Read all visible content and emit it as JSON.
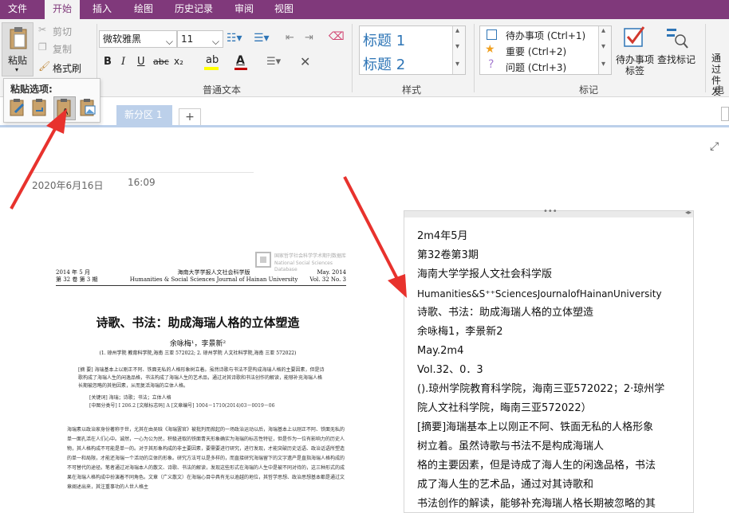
{
  "menu": {
    "tabs": [
      "文件",
      "开始",
      "插入",
      "绘图",
      "历史记录",
      "审阅",
      "视图"
    ],
    "active": "开始"
  },
  "ribbon": {
    "clipboard": {
      "paste": "粘贴",
      "cut": "剪切",
      "copy": "复制",
      "format_painter": "格式刷"
    },
    "font": {
      "name": "微软雅黑",
      "size": "11",
      "group_label": "普通文本",
      "bold": "B",
      "italic": "I",
      "underline": "U",
      "strike": "abc",
      "subscript": "x₂",
      "font_color_letter": "A"
    },
    "styles": {
      "items": [
        "标题 1",
        "标题 2"
      ],
      "group_label": "样式"
    },
    "tags": {
      "items": [
        "待办事项 (Ctrl+1)",
        "重要 (Ctrl+2)",
        "问题 (Ctrl+3)"
      ],
      "todo_tag": "待办事项\n标签",
      "todo_line1": "待办事项",
      "todo_line2": "标签",
      "find_tags": "查找标记",
      "group_label": "标记"
    },
    "partial": {
      "line1": "通过",
      "line2": "件发",
      "line3": "电子"
    }
  },
  "paste_options": {
    "title": "粘贴选项:"
  },
  "sections": {
    "active": "新分区 1",
    "add": "+"
  },
  "page": {
    "date": "2020年6月16日",
    "time": "16:09"
  },
  "document": {
    "header_left_1": "2014 年 5 月",
    "header_left_2": "第 32 卷 第 3 期",
    "header_center_1": "海南大学学报人文社会科学版",
    "header_center_2": "Humanities & Social Sciences Journal of Hainan University",
    "header_right_1": "May. 2014",
    "header_right_2": "Vol. 32  No. 3",
    "watermark_1": "国家哲学社会科学学术期刊数据库",
    "watermark_2": "National Social Sciences Database",
    "title": "诗歌、书法：助成海瑞人格的立体塑造",
    "authors": "余咏梅¹，李景新²",
    "affiliation": "(1. 琼州学院 教育科学院,海南 三亚 572022; 2. 琼州学院 人文社科学院,海南 三亚 572022)",
    "abstract": "[摘  要] 海瑞基本上以刚正不阿、铁面无私的人格形象树立着。虽然诗歌与书法不是构成海瑞人格的主要因素，但是诗歌构成了海瑞人生的闲逸品格，书法构成了海瑞人生的艺术品，通过对其诗歌和书法创作的解读，能够补充海瑞人格长期被忽略的其他因素，从而复活海瑞的立体人格。",
    "keywords": "[关键词] 海瑞；诗歌；书法；立体人格",
    "classification": "[中图分类号] I 206.2     [文献标志码] A     [文章编号] 1004－1710(2014)03－0019－06",
    "body": "海瑞素以政治家身份著称于世，尤其在由吴晗《海瑞罢官》被批判而掀起的一场政治运动以后，海瑞基本上以刚正不阿、铁面无私的单一面孔活在人们心中。诚然，一心为公为民，积极进取的铁面青天形象确实为海瑞的标志性特征，但是作为一位有影响力的历史人物，其人格构成不可能是单一的。对于其形象构成的非主要因素，要需要进行研究，进行发现，才能突破历史话语、政治话语所塑造的单一和局限，才能还海瑞一个活动的立体的形象。研究方法可以是多样的，而直接研究海瑞留下的文字遗产是直指海瑞人格构成的不可替代的途径。笔者通过对海瑞本人的散文、诗歌、书法的解读，发现这些形式在海瑞的人生中是被不同对待的，这三种形式的成果在海瑞人格构成中扮演着不同角色。文章（广义散文）在海瑞心目中具有无以逾越的地位，其哲学思想、政治思想基本都是通过文章阐述出来，其注重事功的人世人格主"
  },
  "ocr": {
    "lines": [
      "2m4年5月",
      "第32卷第3期",
      "海南大学学报人文社会科学版",
      "Humanities&S⁺⁺SciencesJournalofHainanUniversity",
      "诗歌、书法：助成海瑞人格的立体塑造",
      "余咏梅1，李景新2",
      "May.2m4",
      "Vol.32、0．3",
      "().琼州学院教育科学院，海南三亚572022；2·琼州学",
      "院人文社科学院，晦南三亚572022）",
      "[摘要]海瑞基本上以刚正不阿、铁面无私的人格形象",
      "树立着。虽然诗歌与书法不是构成海瑞人",
      "格的主要因素，但是诗成了海人生的闲逸品格，书法",
      "成了海人生的艺术品，通过对其诗歌和",
      "书法创作的解读，能够补充海瑞人格长期被忽略的其"
    ]
  },
  "colors": {
    "brand": "#80397b",
    "section_tab": "#bcd0ea",
    "arrow": "#e8322d",
    "heading_blue": "#2e75b6"
  }
}
